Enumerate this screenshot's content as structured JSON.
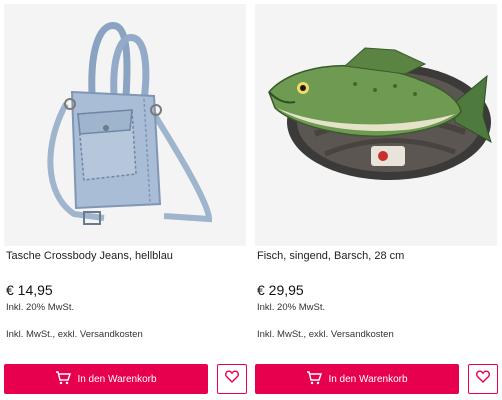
{
  "products": [
    {
      "title": "Tasche Crossbody Jeans, hellblau",
      "price": "€ 14,95",
      "vat_note": "Inkl. 20% MwSt.",
      "shipping_note": "Inkl. MwSt., exkl. Versandkosten",
      "cart_label": "In den Warenkorb",
      "icons": {
        "cart": "shopping-cart-icon",
        "wishlist": "heart-icon"
      }
    },
    {
      "title": "Fisch, singend, Barsch, 28 cm",
      "price": "€ 29,95",
      "vat_note": "Inkl. 20% MwSt.",
      "shipping_note": "Inkl. MwSt., exkl. Versandkosten",
      "cart_label": "In den Warenkorb",
      "icons": {
        "cart": "shopping-cart-icon",
        "wishlist": "heart-icon"
      }
    }
  ],
  "colors": {
    "accent": "#e6004e",
    "image_bg": "#f4f4f4"
  }
}
